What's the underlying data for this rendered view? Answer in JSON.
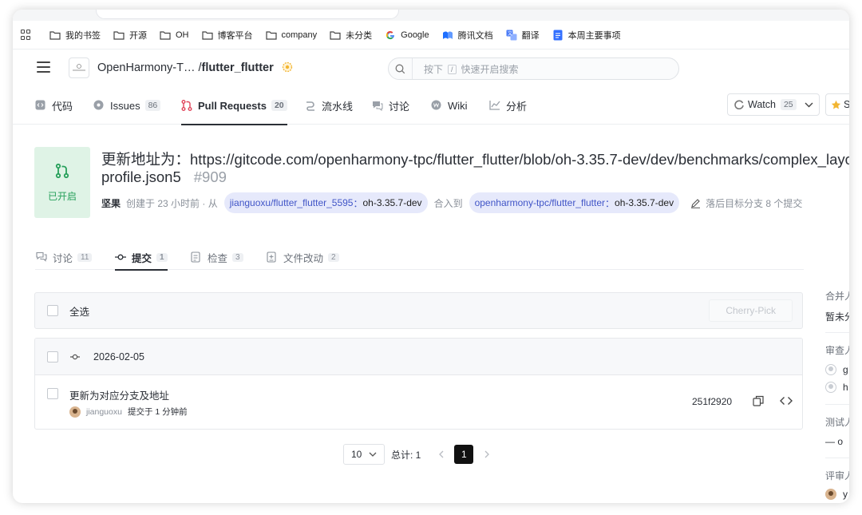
{
  "bookmarks": [
    {
      "label": "我的书签",
      "icon": "folder-icon"
    },
    {
      "label": "开源",
      "icon": "folder-icon"
    },
    {
      "label": "OH",
      "icon": "folder-icon"
    },
    {
      "label": "博客平台",
      "icon": "folder-icon"
    },
    {
      "label": "company",
      "icon": "folder-icon"
    },
    {
      "label": "未分类",
      "icon": "folder-icon"
    },
    {
      "label": "Google",
      "icon": "google-icon"
    },
    {
      "label": "腾讯文档",
      "icon": "tencent-docs-icon"
    },
    {
      "label": "翻译",
      "icon": "translate-icon"
    },
    {
      "label": "本周主要事项",
      "icon": "doc-icon"
    }
  ],
  "header": {
    "org": "OpenHarmony-T…",
    "separator": "/",
    "repo": "flutter_flutter",
    "search_placeholder_prefix": "按下",
    "search_key": "/",
    "search_placeholder_suffix": "快速开启搜索"
  },
  "repo_tabs": [
    {
      "label": "代码",
      "count": ""
    },
    {
      "label": "Issues",
      "count": "86"
    },
    {
      "label": "Pull Requests",
      "count": "20"
    },
    {
      "label": "流水线",
      "count": ""
    },
    {
      "label": "讨论",
      "count": ""
    },
    {
      "label": "Wiki",
      "count": ""
    },
    {
      "label": "分析",
      "count": ""
    }
  ],
  "watch": {
    "label": "Watch",
    "count": "25"
  },
  "star": {
    "label": "S"
  },
  "pr": {
    "status": "已开启",
    "title_line1": "更新地址为：https://gitcode.com/openharmony-tpc/flutter_flutter/blob/oh-3.35.7-dev/dev/benchmarks/complex_layout/",
    "title_line2": "profile.json5",
    "number": "#909",
    "author": "坚果",
    "created": "创建于 23 小时前 · 从",
    "source_repo": "jianguoxu/flutter_flutter_5595",
    "source_branch": "oh-3.35.7-dev",
    "merge_into": "合入到",
    "target_repo": "openharmony-tpc/flutter_flutter",
    "target_branch": "oh-3.35.7-dev",
    "behind": "落后目标分支 8 个提交"
  },
  "content_tabs": [
    {
      "label": "讨论",
      "count": "11"
    },
    {
      "label": "提交",
      "count": "1"
    },
    {
      "label": "检查",
      "count": "3"
    },
    {
      "label": "文件改动",
      "count": "2"
    }
  ],
  "commits": {
    "select_all": "全选",
    "cherry_pick": "Cherry-Pick",
    "date": "2026-02-05",
    "message": "更新为对应分支及地址",
    "author": "jianguoxu",
    "time": "提交于 1 分钟前",
    "sha": "251f2920"
  },
  "pagination": {
    "page_size": "10",
    "total": "总计: 1",
    "current": "1"
  },
  "sidebar": {
    "merge_label": "合并人",
    "merge_value": "暂未分配",
    "review_label": "审查人",
    "reviewer1": "g",
    "reviewer2": "h",
    "test_label": "测试人",
    "test_value": "— o",
    "comment_label": "评审人",
    "commenter": "y"
  },
  "colors": {
    "open_green": "#27a05b",
    "open_bg": "#dff3e6",
    "branch_bg": "#e6e9fb",
    "branch_text": "#4155c7",
    "pr_icon_red": "#e0445a"
  }
}
